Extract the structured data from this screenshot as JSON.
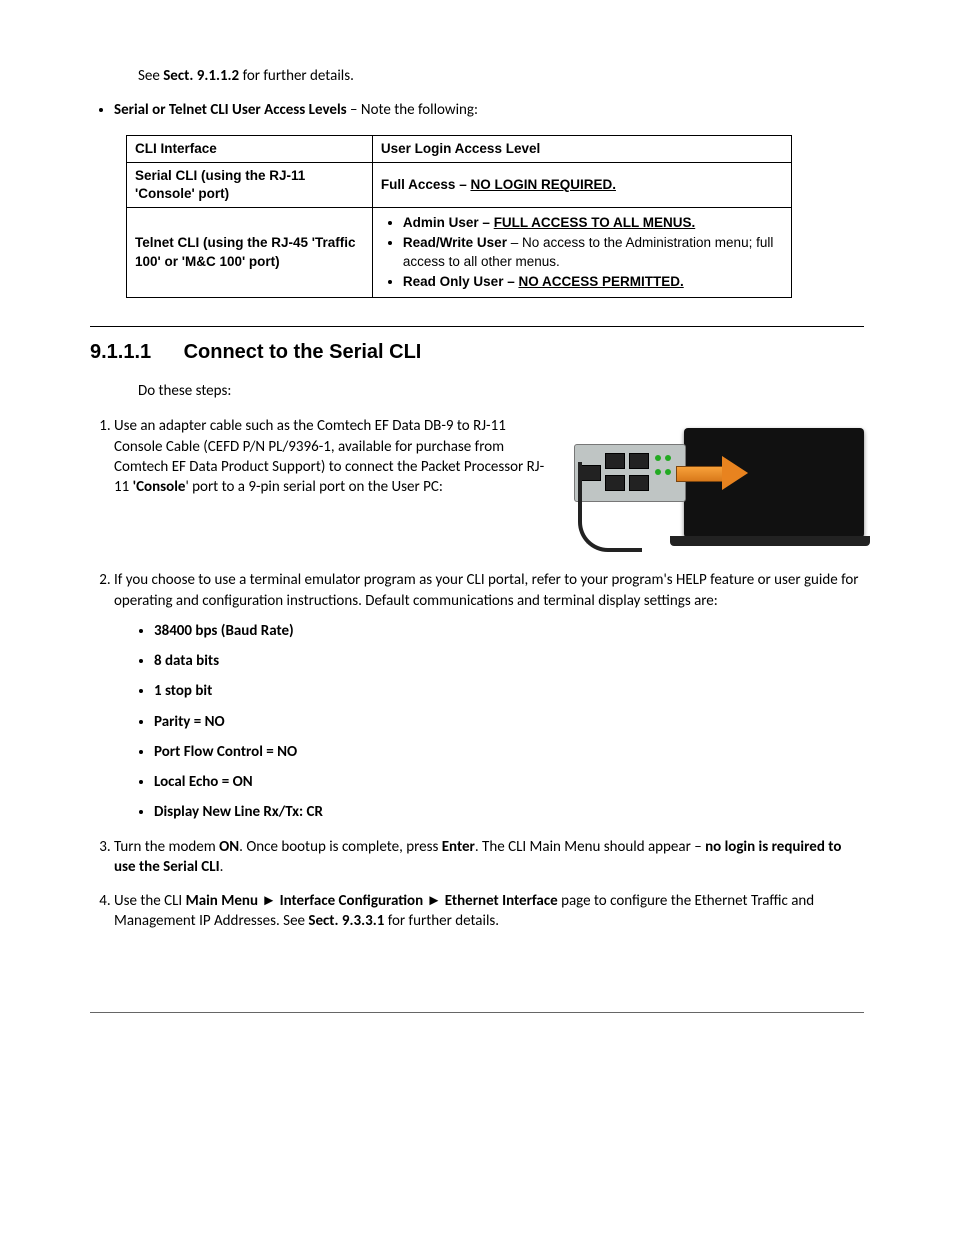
{
  "intro": {
    "see_prefix": "See ",
    "see_ref": "Sect. 9.1.1.2",
    "see_suffix": " for further details.",
    "bullet_bold": "Serial or Telnet CLI User Access Levels",
    "bullet_rest": " – Note the following:"
  },
  "table": {
    "header_col1": "CLI Interface",
    "header_col2": "User Login Access Level",
    "row1_col1": "Serial CLI (using the RJ-11 'Console' port)",
    "row1_col2_prefix": "Full Access – ",
    "row1_col2_u": "NO LOGIN REQUIRED.",
    "row2_col1": "Telnet CLI (using the RJ-45 'Traffic 100' or 'M&C 100' port)",
    "row2_li1_b": "Admin User – ",
    "row2_li1_u": "FULL ACCESS TO ALL MENUS.",
    "row2_li2_b": "Read/Write User",
    "row2_li2_rest": " – No access to the Administration menu; full access to all other menus.",
    "row2_li3_b": "Read Only User – ",
    "row2_li3_u": "NO ACCESS PERMITTED."
  },
  "section": {
    "number": "9.1.1.1",
    "title": "Connect to the Serial CLI"
  },
  "do_steps": "Do these steps:",
  "step1": {
    "t1": "Use an adapter cable such as the Comtech EF Data DB-9 to RJ-11 Console Cable (CEFD P/N PL/9396-1, available for purchase from Comtech EF Data Product Support) to connect the Packet Processor RJ-11 ",
    "b1": "'Console",
    "t2": "' port to a 9-pin serial port on the User PC:"
  },
  "step2": {
    "text": "If you choose to use a terminal emulator program as your CLI portal, refer to your program's HELP feature or user guide for operating and configuration instructions. Default communications and terminal display settings are:",
    "settings": [
      "38400 bps (Baud Rate)",
      "8 data bits",
      "1 stop bit",
      "Parity = NO",
      "Port Flow Control = NO",
      "Local Echo = ON",
      "Display New Line Rx/Tx: CR"
    ]
  },
  "step3": {
    "t1": "Turn the modem ",
    "b1": "ON",
    "t2": ". Once bootup is complete, press ",
    "b2": "Enter",
    "t3": ". The CLI Main Menu should appear – ",
    "b3": "no login is required to use the Serial CLI",
    "t4": "."
  },
  "step4": {
    "t1": "Use the CLI ",
    "b1": "Main Menu ► Interface Configuration ► Ethernet Interface",
    "t2": " page to configure the Ethernet Traffic and Management IP Addresses. See ",
    "b2": "Sect. 9.3.3.1",
    "t3": " for further details."
  }
}
